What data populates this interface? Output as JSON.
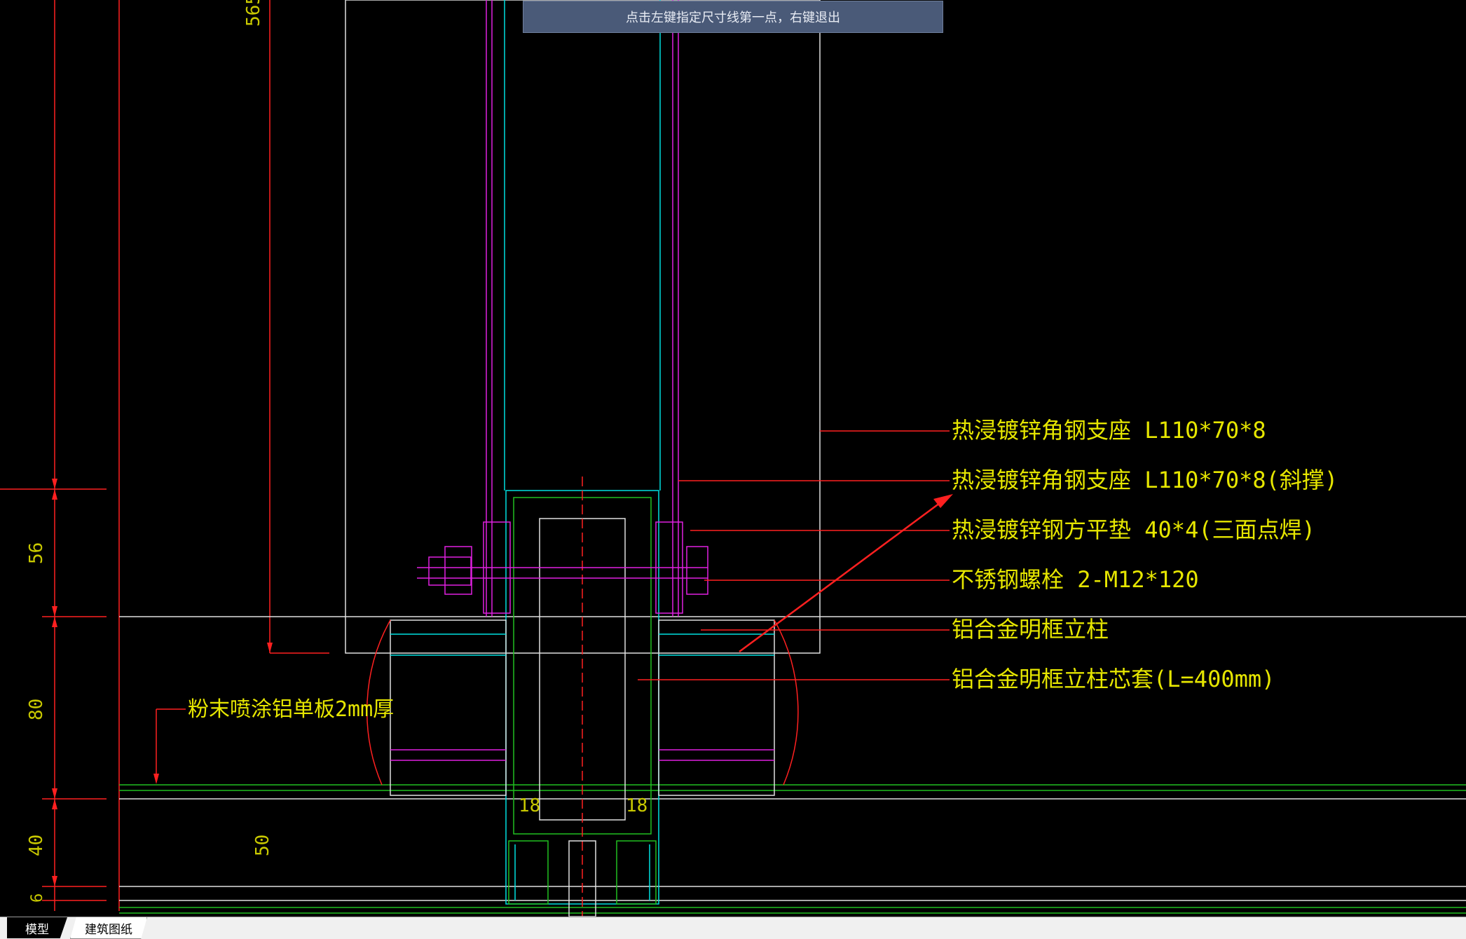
{
  "command_tip": "点击左键指定尺寸线第一点，右键退出",
  "tabs": [
    {
      "label": "模型",
      "active": true
    },
    {
      "label": "建筑图纸",
      "active": false
    }
  ],
  "annotations": {
    "a1": "热浸镀锌角钢支座 L110*70*8",
    "a2": "热浸镀锌角钢支座 L110*70*8(斜撑)",
    "a3": "热浸镀锌钢方平垫 40*4(三面点焊)",
    "a4": "不锈钢螺栓 2-M12*120",
    "a5": "铝合金明框立柱",
    "a6": "铝合金明框立柱芯套(L=400mm)",
    "a7": "粉末喷涂铝单板2mm厚"
  },
  "dimensions": {
    "d565": "565",
    "d56": "56",
    "d80": "80",
    "d40": "40",
    "d6": "6",
    "d50": "50",
    "d18a": "18",
    "d18b": "18"
  },
  "colors": {
    "background": "#000000",
    "dimension_line": "#ff2020",
    "text": "#e6e600",
    "cyan": "#00e0e0",
    "magenta": "#e020e0",
    "green": "#20c020",
    "white": "#e0e0e0"
  }
}
